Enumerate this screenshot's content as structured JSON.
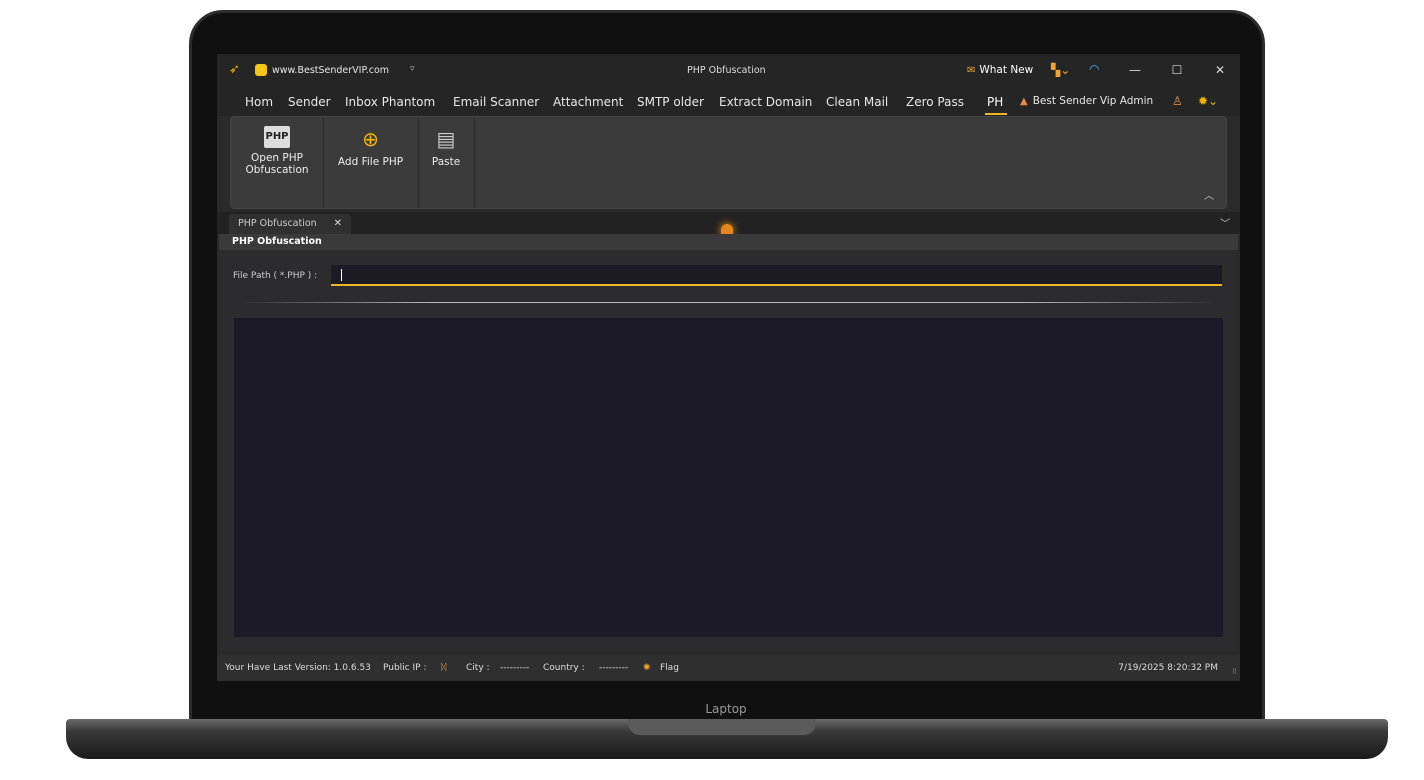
{
  "device": {
    "label": "Laptop"
  },
  "titlebar": {
    "site_url": "www.BestSenderVIP.com",
    "window_title": "PHP Obfuscation",
    "whats_new": "What New"
  },
  "menu": {
    "items": [
      "Hom",
      "Sender",
      "Inbox Phantom",
      "Email Scanner",
      "Attachment",
      "SMTP older",
      "Extract Domain",
      "Clean Mail",
      "Zero Pass",
      "PH"
    ],
    "active": "PH",
    "admin": "Best Sender Vip Admin"
  },
  "ribbon": {
    "open_php": "Open PHP Obfuscation",
    "open_php_line1": "Open PHP",
    "open_php_line2": "Obfuscation",
    "add_file": "Add File PHP",
    "paste": "Paste"
  },
  "doc_tab": {
    "label": "PHP Obfuscation",
    "close": "✕"
  },
  "panel": {
    "header": "PHP Obfuscation",
    "file_path_label": "File Path ( *.PHP ) :",
    "file_path_value": ""
  },
  "status": {
    "version": "Your Have Last Version: 1.0.6.53",
    "public_ip_label": "Public IP :",
    "city_label": "City :",
    "city_value": "---------",
    "country_label": "Country :",
    "country_value": "---------",
    "flag_label": "Flag",
    "datetime": "7/19/2025 8:20:32 PM"
  },
  "colors": {
    "accent": "#f0b429",
    "background": "#2a2a2a",
    "output_bg": "#1c1a26"
  }
}
